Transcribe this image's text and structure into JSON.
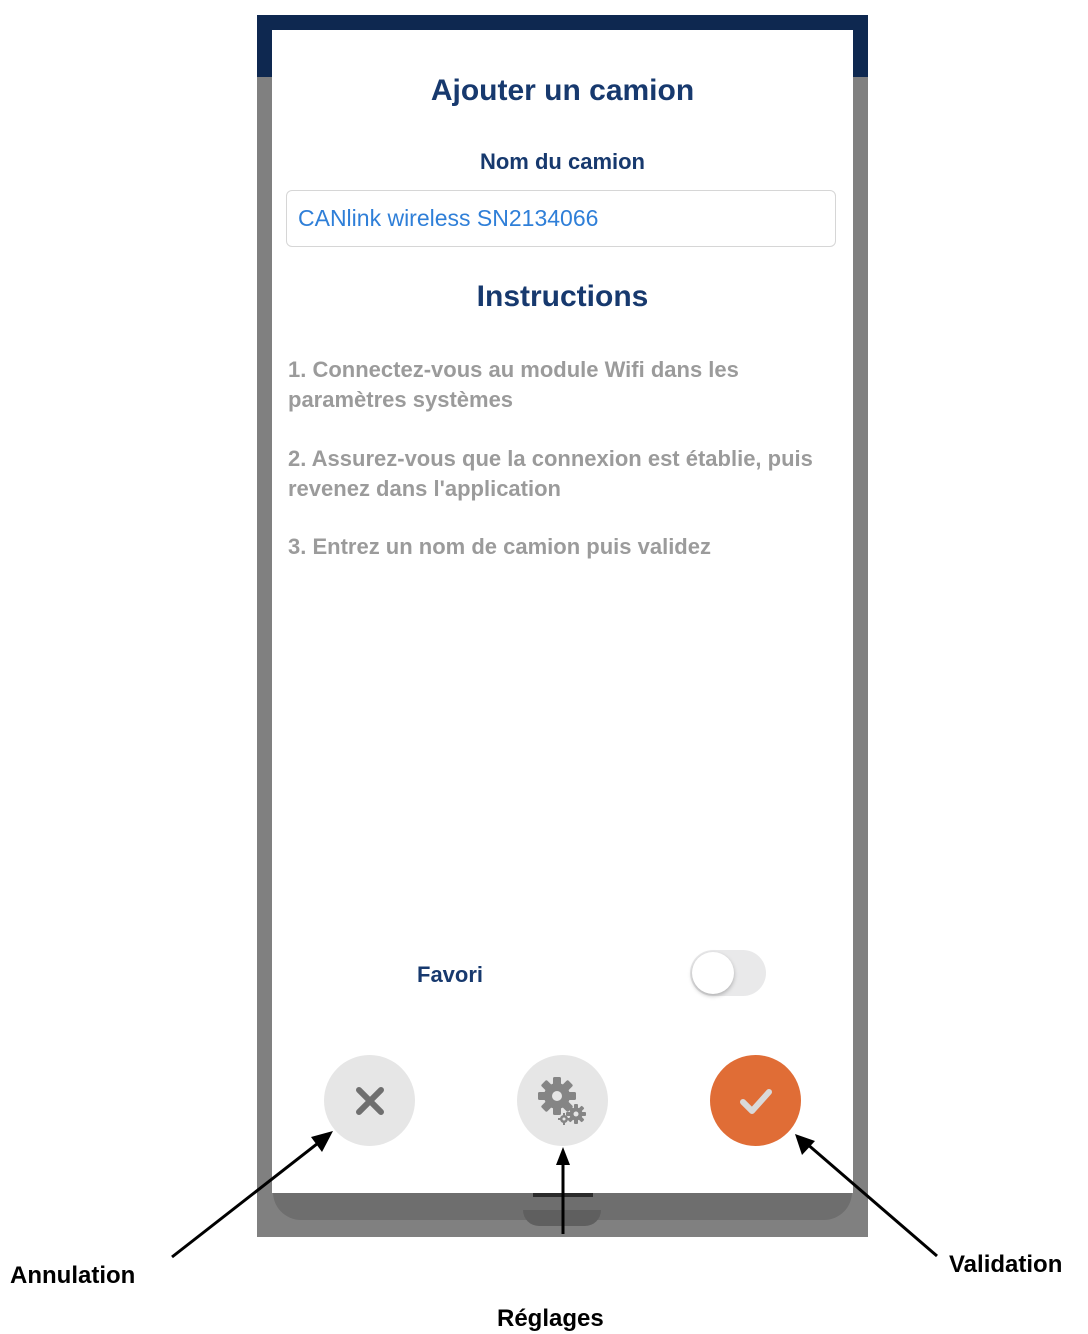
{
  "modal": {
    "title": "Ajouter un camion",
    "name_label": "Nom du camion",
    "name_value": "CANlink wireless SN2134066",
    "instructions_title": "Instructions",
    "steps": [
      "1. Connectez-vous au module Wifi dans les paramètres systèmes",
      "2. Assurez-vous que la connexion est établie, puis revenez dans l'application",
      "3. Entrez un nom de camion puis validez"
    ],
    "favori_label": "Favori",
    "favori_on": false
  },
  "buttons": {
    "cancel_icon": "close-icon",
    "settings_icon": "gears-icon",
    "validate_icon": "checkmark-icon",
    "validate_color": "#e06d36"
  },
  "annotations": {
    "cancel": "Annulation",
    "settings": "Réglages",
    "validate": "Validation"
  },
  "colors": {
    "header": "#0e2850",
    "title": "#17396e",
    "input_text": "#2f7fd8",
    "step_text": "#9b9b9b"
  }
}
